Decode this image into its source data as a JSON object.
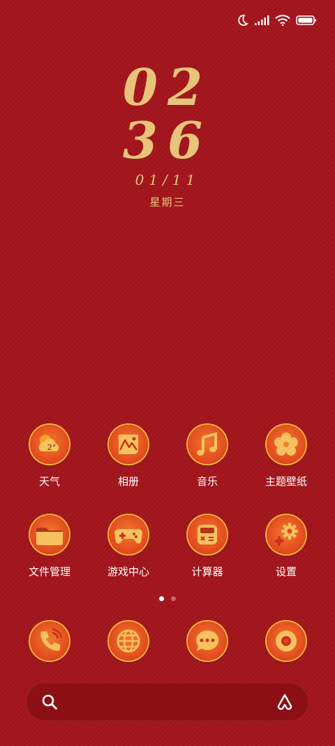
{
  "status_bar": {
    "icons": [
      "moon-icon",
      "signal-icon",
      "wifi-icon",
      "battery-icon"
    ]
  },
  "lockclock": {
    "hour": "02",
    "minute": "36",
    "date": "01/11",
    "weekday": "星期三"
  },
  "apps_row1": [
    {
      "label": "天气",
      "icon": "weather-icon",
      "badge": "2°"
    },
    {
      "label": "相册",
      "icon": "gallery-icon"
    },
    {
      "label": "音乐",
      "icon": "music-icon"
    },
    {
      "label": "主题壁纸",
      "icon": "themes-icon"
    }
  ],
  "apps_row2": [
    {
      "label": "文件管理",
      "icon": "folder-icon"
    },
    {
      "label": "游戏中心",
      "icon": "gamepad-icon"
    },
    {
      "label": "计算器",
      "icon": "calculator-icon"
    },
    {
      "label": "设置",
      "icon": "gear-icon"
    }
  ],
  "dock": [
    {
      "icon": "phone-icon"
    },
    {
      "icon": "browser-globe-icon"
    },
    {
      "icon": "messages-icon"
    },
    {
      "icon": "camera-icon"
    }
  ],
  "page_indicator": {
    "count": 2,
    "active": 1
  },
  "search_bar": {
    "left_icon": "search-icon",
    "right_icon": "assistant-icon"
  },
  "colors": {
    "background": "#a3151c",
    "gold": "#e7c47a",
    "icon_orange": "#e2481e",
    "icon_rim": "#f2b63c"
  }
}
